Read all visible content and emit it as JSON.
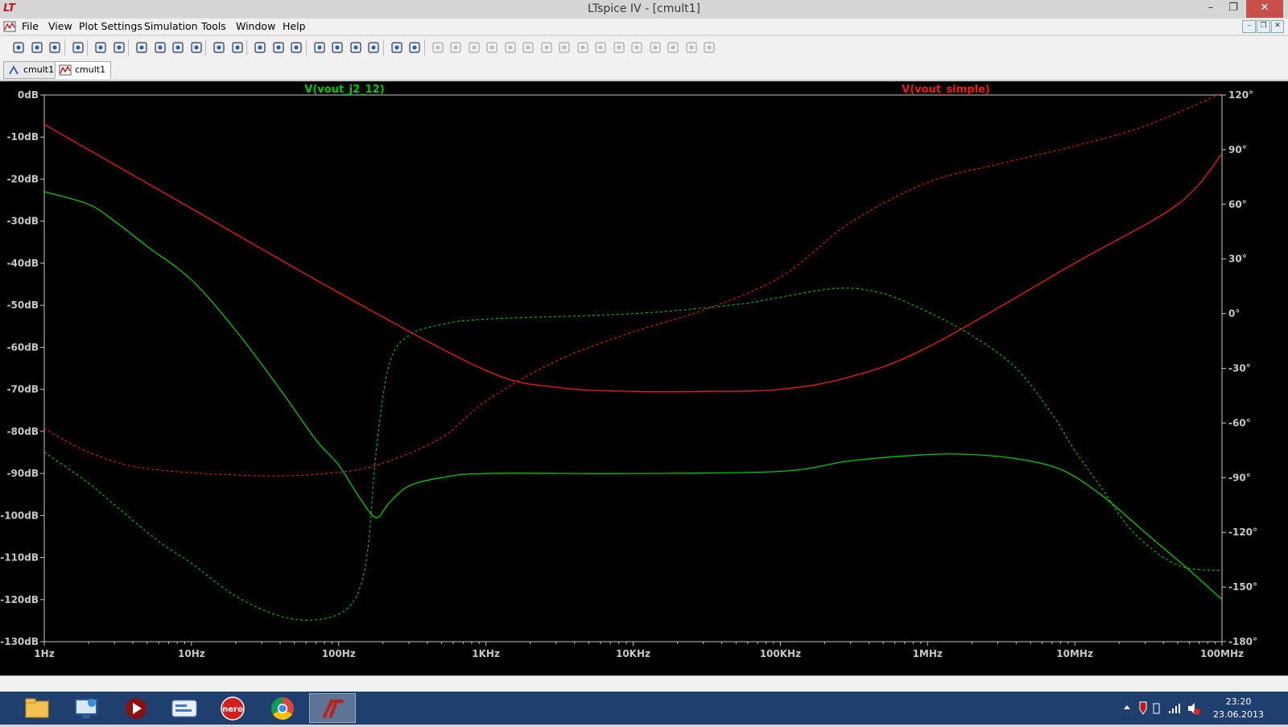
{
  "window": {
    "title": "LTspice IV - [cmult1]",
    "minimize_glyph": "–",
    "restore_glyph": "❐",
    "close_glyph": "✕"
  },
  "menu": [
    "File",
    "View",
    "Plot Settings",
    "Simulation",
    "Tools",
    "Window",
    "Help"
  ],
  "mdi_buttons": [
    "–",
    "❐",
    "✕"
  ],
  "tabs": [
    {
      "label": "cmult1",
      "icon": "schematic-icon"
    },
    {
      "label": "cmult1",
      "icon": "waveform-icon"
    }
  ],
  "toolbar_icons": [
    "new-schematic-icon",
    "open-icon",
    "save-icon",
    "control-panel-icon",
    "run-icon",
    "halt-icon",
    "zoom-in-icon",
    "zoom-out-icon",
    "zoom-fit-icon",
    "zoom-cancel-icon",
    "autorange-icon",
    "zoom-extents-icon",
    "tile-horizontal-icon",
    "cascade-icon",
    "tile-vertical-icon",
    "cut-icon",
    "copy-icon",
    "paste-icon",
    "find-icon",
    "print-preview-icon",
    "print-icon",
    "wire-icon",
    "ground-icon",
    "label-icon",
    "resistor-icon",
    "capacitor-icon",
    "inductor-icon",
    "diode-icon",
    "component-icon",
    "move-icon",
    "drag-icon",
    "undo-icon",
    "redo-icon",
    "rotate-icon",
    "mirror-icon",
    "text-icon",
    "spice-directive-icon"
  ],
  "colors": {
    "green_trace": "#00c800",
    "red_trace": "#ee1c1c",
    "axis": "#c8c8c8",
    "background": "#000000"
  },
  "chart_data": {
    "type": "line",
    "x_scale": "log",
    "xlim": [
      1,
      100000000
    ],
    "x_ticks": [
      "1Hz",
      "10Hz",
      "100Hz",
      "1KHz",
      "10KHz",
      "100KHz",
      "1MHz",
      "10MHz",
      "100MHz"
    ],
    "y_left_ticks": [
      "0dB",
      "-10dB",
      "-20dB",
      "-30dB",
      "-40dB",
      "-50dB",
      "-60dB",
      "-70dB",
      "-80dB",
      "-90dB",
      "-100dB",
      "-110dB",
      "-120dB",
      "-130dB"
    ],
    "ylim_left": [
      -130,
      0
    ],
    "y_right_ticks": [
      "120°",
      "90°",
      "60°",
      "30°",
      "0°",
      "-30°",
      "-60°",
      "-90°",
      "-120°",
      "-150°",
      "-180°"
    ],
    "ylim_right": [
      -180,
      120
    ],
    "series": [
      {
        "name": "V(vout_j2_12)",
        "color": "#00c800",
        "magnitude_db": [
          [
            1,
            -23
          ],
          [
            2,
            -26
          ],
          [
            3,
            -30
          ],
          [
            5,
            -36
          ],
          [
            10,
            -44
          ],
          [
            20,
            -56
          ],
          [
            40,
            -70
          ],
          [
            70,
            -82
          ],
          [
            100,
            -88
          ],
          [
            140,
            -96
          ],
          [
            180,
            -100.5
          ],
          [
            220,
            -97
          ],
          [
            300,
            -93
          ],
          [
            500,
            -91
          ],
          [
            1000,
            -90
          ],
          [
            10000,
            -90
          ],
          [
            100000,
            -89.5
          ],
          [
            300000,
            -87
          ],
          [
            1000000,
            -85.5
          ],
          [
            2000000,
            -85.5
          ],
          [
            4000000,
            -86.5
          ],
          [
            8000000,
            -89
          ],
          [
            15000000,
            -95
          ],
          [
            30000000,
            -104
          ],
          [
            60000000,
            -113
          ],
          [
            100000000,
            -120
          ]
        ],
        "phase_deg": [
          [
            1,
            -76
          ],
          [
            2,
            -93
          ],
          [
            3,
            -105
          ],
          [
            6,
            -125
          ],
          [
            10,
            -137
          ],
          [
            20,
            -155
          ],
          [
            40,
            -166
          ],
          [
            70,
            -168
          ],
          [
            110,
            -163
          ],
          [
            140,
            -150
          ],
          [
            160,
            -125
          ],
          [
            180,
            -75
          ],
          [
            220,
            -28
          ],
          [
            300,
            -12
          ],
          [
            500,
            -6
          ],
          [
            1000,
            -3
          ],
          [
            10000,
            0
          ],
          [
            50000,
            5
          ],
          [
            100000,
            9
          ],
          [
            250000,
            14
          ],
          [
            500000,
            11
          ],
          [
            1000000,
            1
          ],
          [
            2000000,
            -12
          ],
          [
            4000000,
            -30
          ],
          [
            7000000,
            -55
          ],
          [
            10000000,
            -75
          ],
          [
            15000000,
            -95
          ],
          [
            25000000,
            -120
          ],
          [
            50000000,
            -138
          ],
          [
            100000000,
            -141
          ]
        ]
      },
      {
        "name": "V(vout_simple)",
        "color": "#ee1c1c",
        "magnitude_db": [
          [
            1,
            -7
          ],
          [
            10,
            -27
          ],
          [
            100,
            -47
          ],
          [
            1000,
            -65.5
          ],
          [
            3000,
            -69.5
          ],
          [
            10000,
            -70.5
          ],
          [
            30000,
            -70.5
          ],
          [
            100000,
            -70
          ],
          [
            300000,
            -67
          ],
          [
            1000000,
            -60
          ],
          [
            10000000,
            -40
          ],
          [
            50000000,
            -26
          ],
          [
            100000000,
            -14
          ]
        ],
        "phase_deg": [
          [
            1,
            -63
          ],
          [
            2,
            -76
          ],
          [
            5,
            -85
          ],
          [
            30,
            -89
          ],
          [
            100,
            -87
          ],
          [
            200,
            -82
          ],
          [
            500,
            -68
          ],
          [
            1000,
            -48
          ],
          [
            3000,
            -26
          ],
          [
            10000,
            -10
          ],
          [
            30000,
            2
          ],
          [
            100000,
            20
          ],
          [
            300000,
            50
          ],
          [
            1000000,
            72
          ],
          [
            3000000,
            82
          ],
          [
            10000000,
            92
          ],
          [
            30000000,
            103
          ],
          [
            100000000,
            121
          ]
        ]
      }
    ]
  },
  "taskbar": {
    "apps": [
      "file-explorer-icon",
      "remote-desktop-icon",
      "media-player-icon",
      "messenger-icon",
      "nero-icon",
      "chrome-icon",
      "ltspice-icon"
    ],
    "nero_label": "nero",
    "tray_icons": [
      "show-hidden-icon",
      "antivirus-icon",
      "power-icon",
      "network-signal-icon",
      "volume-muted-icon"
    ],
    "time": "23:20",
    "date": "23.06.2013"
  }
}
